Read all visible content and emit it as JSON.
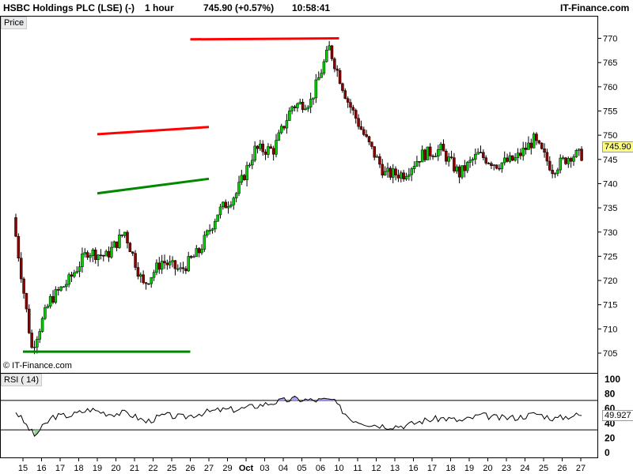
{
  "header": {
    "instrument": "HSBC Holdings PLC (LSE) (-)",
    "timeframe": "1 hour",
    "last_quote": "745.90 (+0.57%)",
    "time": "10:58:41",
    "brand": "IT-Finance.com"
  },
  "price_panel": {
    "label": "Price",
    "watermark": "© IT-Finance.com",
    "last_price_tag": "745.90",
    "y_ticks": [
      "770",
      "765",
      "760",
      "755",
      "750",
      "745",
      "740",
      "735",
      "730",
      "725",
      "720",
      "715",
      "710",
      "705"
    ]
  },
  "rsi_panel": {
    "label": "RSI ( 14)",
    "value_tag": "49.927",
    "y_ticks": [
      "100",
      "80",
      "60",
      "40",
      "20",
      "0"
    ],
    "levels": [
      30,
      70
    ]
  },
  "x_axis": {
    "ticks": [
      "15",
      "16",
      "17",
      "18",
      "19",
      "20",
      "21",
      "22",
      "25",
      "26",
      "27",
      "29",
      "Oct",
      "03",
      "04",
      "05",
      "06",
      "10",
      "11",
      "12",
      "13",
      "16",
      "17",
      "18",
      "19",
      "20",
      "23",
      "24",
      "25",
      "26",
      "27"
    ]
  },
  "colors": {
    "up_candle": "#00d000",
    "down_candle": "#8b0000",
    "resistance": "#ff0000",
    "support": "#008800",
    "rsi_line": "#000000",
    "rsi_overbought_fill": "#b0a0ff",
    "rsi_oversold_fill": "#90d090",
    "grid": "#000000",
    "tag_bg": "#ffff80"
  },
  "chart_data": [
    {
      "type": "line",
      "title": "",
      "ylim": [
        703,
        772
      ],
      "grid": false,
      "series": [
        {
          "name": "",
          "x": [
            "15",
            "16",
            "17",
            "18",
            "19",
            "20",
            "21",
            "22",
            "25",
            "26",
            "27",
            "29",
            "Oct",
            "03",
            "04",
            "05",
            "06",
            "10",
            "11",
            "12",
            "13",
            "16",
            "17",
            "18",
            "19",
            "20",
            "23",
            "24",
            "25",
            "26",
            "27"
          ],
          "values": [
            733,
            706,
            716,
            720,
            726,
            725,
            730,
            719,
            724,
            722,
            726,
            734,
            738,
            747,
            747,
            756,
            757,
            768,
            757,
            749,
            742,
            742,
            746,
            747,
            742,
            746,
            744,
            745,
            749,
            743,
            745.9
          ]
        }
      ],
      "trendlines": [
        {
          "color": "red",
          "from": [
            "10",
            770
          ],
          "to": [
            "26",
            769.8
          ]
        },
        {
          "color": "red",
          "from": [
            "19",
            750.2
          ],
          "to": [
            "27",
            751.7
          ]
        },
        {
          "color": "green",
          "from": [
            "19",
            738
          ],
          "to": [
            "27",
            741
          ]
        },
        {
          "color": "green",
          "from": [
            "15",
            705.3
          ],
          "to": [
            "26",
            705.3
          ]
        }
      ],
      "last_price": 745.9
    },
    {
      "type": "line",
      "title": "RSI ( 14)",
      "ylim": [
        0,
        100
      ],
      "levels": [
        30,
        70
      ],
      "series": [
        {
          "name": "RSI ( 14)",
          "x": [
            "15",
            "16",
            "17",
            "18",
            "19",
            "20",
            "21",
            "22",
            "25",
            "26",
            "27",
            "29",
            "Oct",
            "03",
            "04",
            "05",
            "06",
            "10",
            "11",
            "12",
            "13",
            "16",
            "17",
            "18",
            "19",
            "20",
            "23",
            "24",
            "25",
            "26",
            "27"
          ],
          "values": [
            55,
            22,
            48,
            50,
            58,
            52,
            53,
            41,
            50,
            47,
            53,
            57,
            58,
            63,
            68,
            72,
            70,
            71,
            45,
            38,
            35,
            36,
            43,
            46,
            42,
            50,
            46,
            47,
            52,
            45,
            49.927
          ]
        }
      ],
      "last_value": 49.927
    }
  ]
}
